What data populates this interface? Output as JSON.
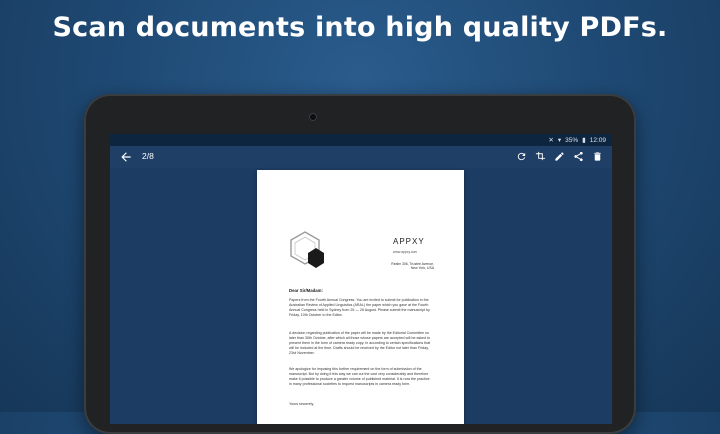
{
  "headline": "Scan documents into high quality PDFs.",
  "status": {
    "battery": "35%",
    "time": "12:09"
  },
  "appbar": {
    "page_indicator": "2/8"
  },
  "icons": {
    "back": "arrow-back-icon",
    "rotate": "rotate-icon",
    "crop": "crop-icon",
    "edit": "edit-icon",
    "share": "share-icon",
    "delete": "delete-icon"
  },
  "document": {
    "company": "APPXY",
    "website": "www.appxy.com",
    "address": "Realm 306, Trustee Avenue, New York, USA",
    "greeting": "Dear Sir/Madam:",
    "para1": "Papers from the Fourth Annual Congress. You are invited to submit for publication in the Australian Review of Applied Linguistics (ARAL) the paper which you gave at the Fourth Annual Congress held in Sydney from 25 — 28 August. Please submit the manuscript by Friday, 10th October to the Editor.",
    "para2": "A decision regarding publication of the paper will be made by the Editorial Committee no later than 30th October, after which all those whose papers are accepted will be asked to present them in the form of camera ready copy. In according to certain specifications that will be included at the time. Drafts should be received by the Editor not later than Friday, 23rd November.",
    "para3": "We apologize for imposing this further requirement on the form of submission of the manuscript. But by doing it this way we can cut the cost very considerably and therefore make it possible to produce a greater volume of published material. It is now the practice in many professional societies to request manuscripts in camera ready form.",
    "closing": "Yours sincerely,"
  },
  "colors": {
    "background": "#1f4a75",
    "appbar": "#203f66",
    "statusbar": "#0e2540"
  }
}
